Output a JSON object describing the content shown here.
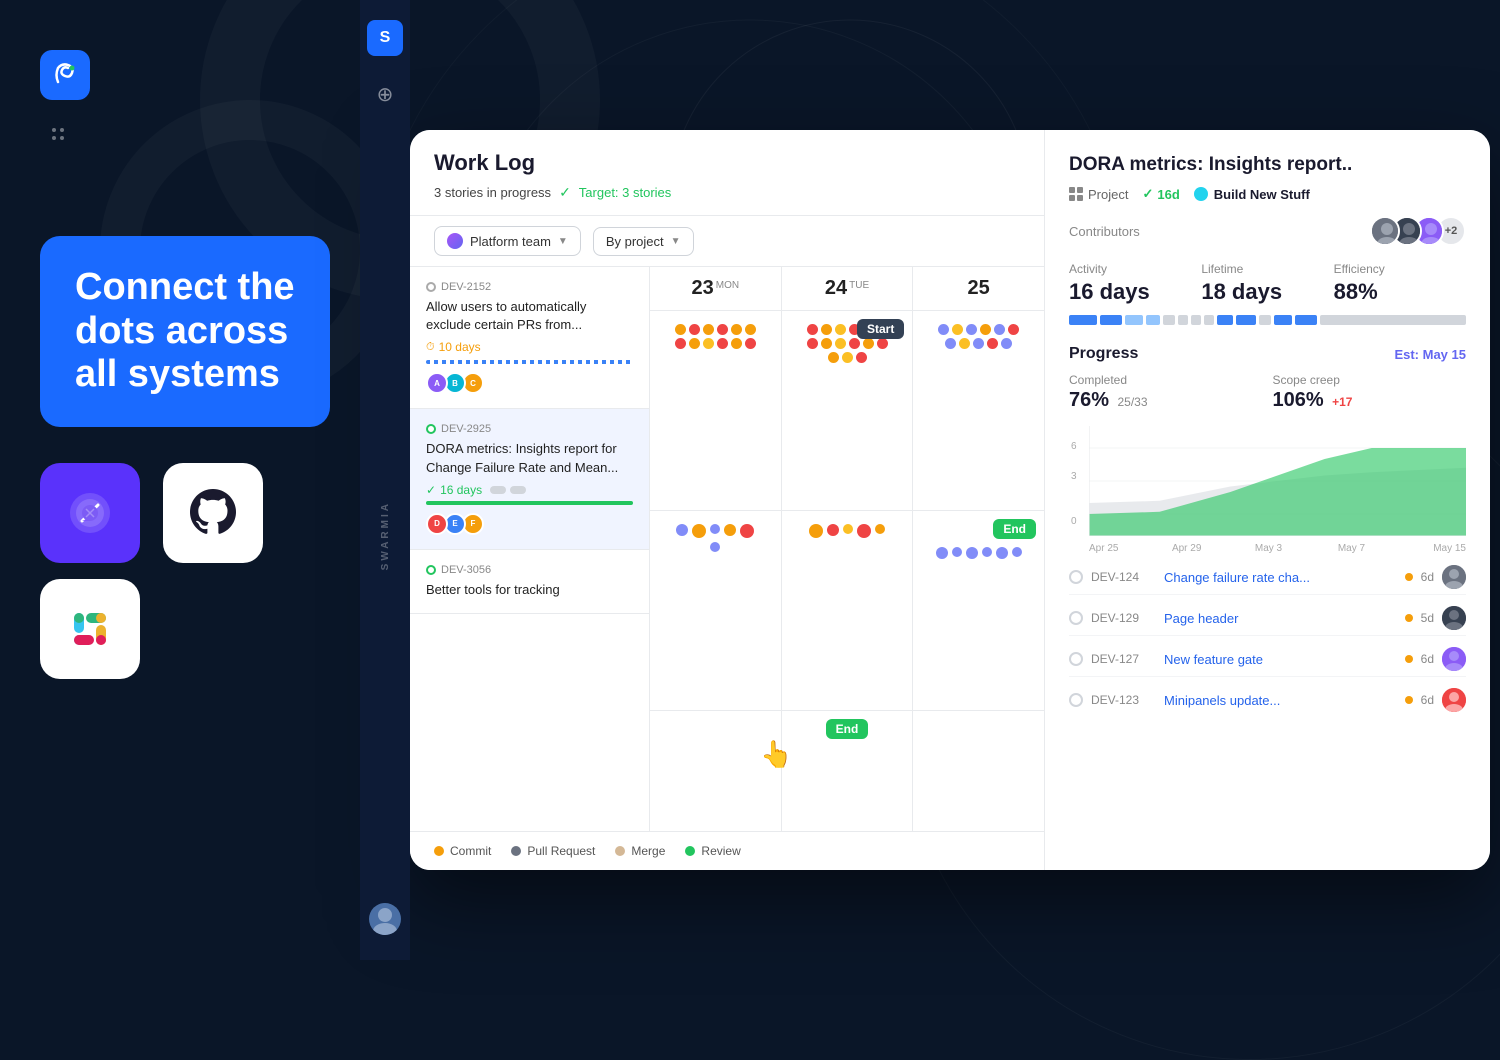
{
  "background": {
    "color": "#0a1628"
  },
  "hero": {
    "title": "Connect the dots across all systems",
    "logo_text": "S"
  },
  "sidebar": {
    "nav_items": [
      "S",
      "⊕"
    ],
    "label": "SWARMIA"
  },
  "worklog": {
    "title": "Work Log",
    "stats_text": "3 stories in progress",
    "target_text": "Target: 3 stories",
    "team_filter": "Platform team",
    "project_filter": "By project",
    "days": [
      {
        "num": "23",
        "label": "MON"
      },
      {
        "num": "24",
        "label": "TUE"
      },
      {
        "num": "25",
        "label": "..."
      }
    ],
    "stories": [
      {
        "id": "DEV-2152",
        "title": "Allow users to automatically exclude certain PRs from...",
        "days": "10 days",
        "days_color": "orange",
        "progress_type": "dashed"
      },
      {
        "id": "DEV-2925",
        "title": "DORA metrics: Insights report for Change Failure Rate and Mean...",
        "days": "16 days",
        "days_color": "green",
        "progress_type": "solid"
      },
      {
        "id": "DEV-3056",
        "title": "Better tools for tracking",
        "days": "",
        "days_color": "orange",
        "progress_type": "none"
      }
    ],
    "legend": [
      {
        "label": "Commit",
        "color": "#f59e0b"
      },
      {
        "label": "Pull Request",
        "color": "#6b7280"
      },
      {
        "label": "Merge",
        "color": "#d4b896"
      },
      {
        "label": "Review",
        "color": "#22c55e"
      }
    ]
  },
  "dora": {
    "title": "DORA metrics: Insights report..",
    "project_label": "Project",
    "days": "16d",
    "team_name": "Build New Stuff",
    "contributors_label": "Contributors",
    "metrics": [
      {
        "label": "Activity",
        "value": "16 days"
      },
      {
        "label": "Lifetime",
        "value": "18 days"
      },
      {
        "label": "Efficiency",
        "value": "88%"
      }
    ],
    "progress": {
      "title": "Progress",
      "est": "Est: May 15",
      "completed_label": "Completed",
      "completed_value": "76%",
      "completed_sub": "25/33",
      "scope_label": "Scope creep",
      "scope_value": "106%",
      "scope_sub": "+17"
    },
    "chart_labels_x": [
      "Apr 25",
      "Apr 29",
      "May 3",
      "May 7",
      "May 15"
    ],
    "chart_labels_y": [
      "6",
      "3",
      "0"
    ],
    "issues": [
      {
        "id": "DEV-124",
        "title": "Change failure rate cha...",
        "days": "6d"
      },
      {
        "id": "DEV-129",
        "title": "Page header",
        "days": "5d"
      },
      {
        "id": "DEV-127",
        "title": "New feature gate",
        "days": "6d"
      },
      {
        "id": "DEV-123",
        "title": "Minipanels update...",
        "days": "6d"
      }
    ]
  },
  "integrations": [
    {
      "name": "Linear",
      "emoji": "⬡",
      "bg": "#5a32fb"
    },
    {
      "name": "GitHub",
      "symbol": "github",
      "bg": "#ffffff"
    },
    {
      "name": "Slack",
      "symbol": "slack",
      "bg": "#ffffff"
    }
  ]
}
